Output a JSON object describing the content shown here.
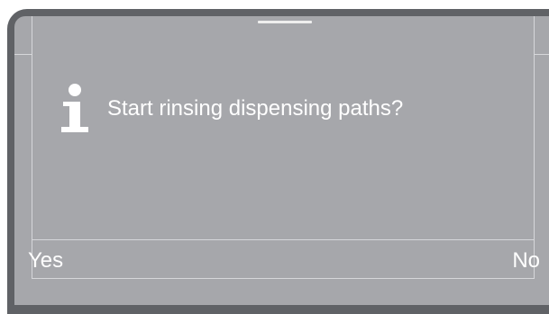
{
  "dialog": {
    "icon": "info-icon",
    "message": "Start rinsing dispensing paths?"
  },
  "softkeys": {
    "yes_label": "Yes",
    "no_label": "No"
  },
  "colors": {
    "bezel": "#606266",
    "screen": "#a6a7ab",
    "text": "#ffffff",
    "frame_lines": "#d6d7da"
  }
}
